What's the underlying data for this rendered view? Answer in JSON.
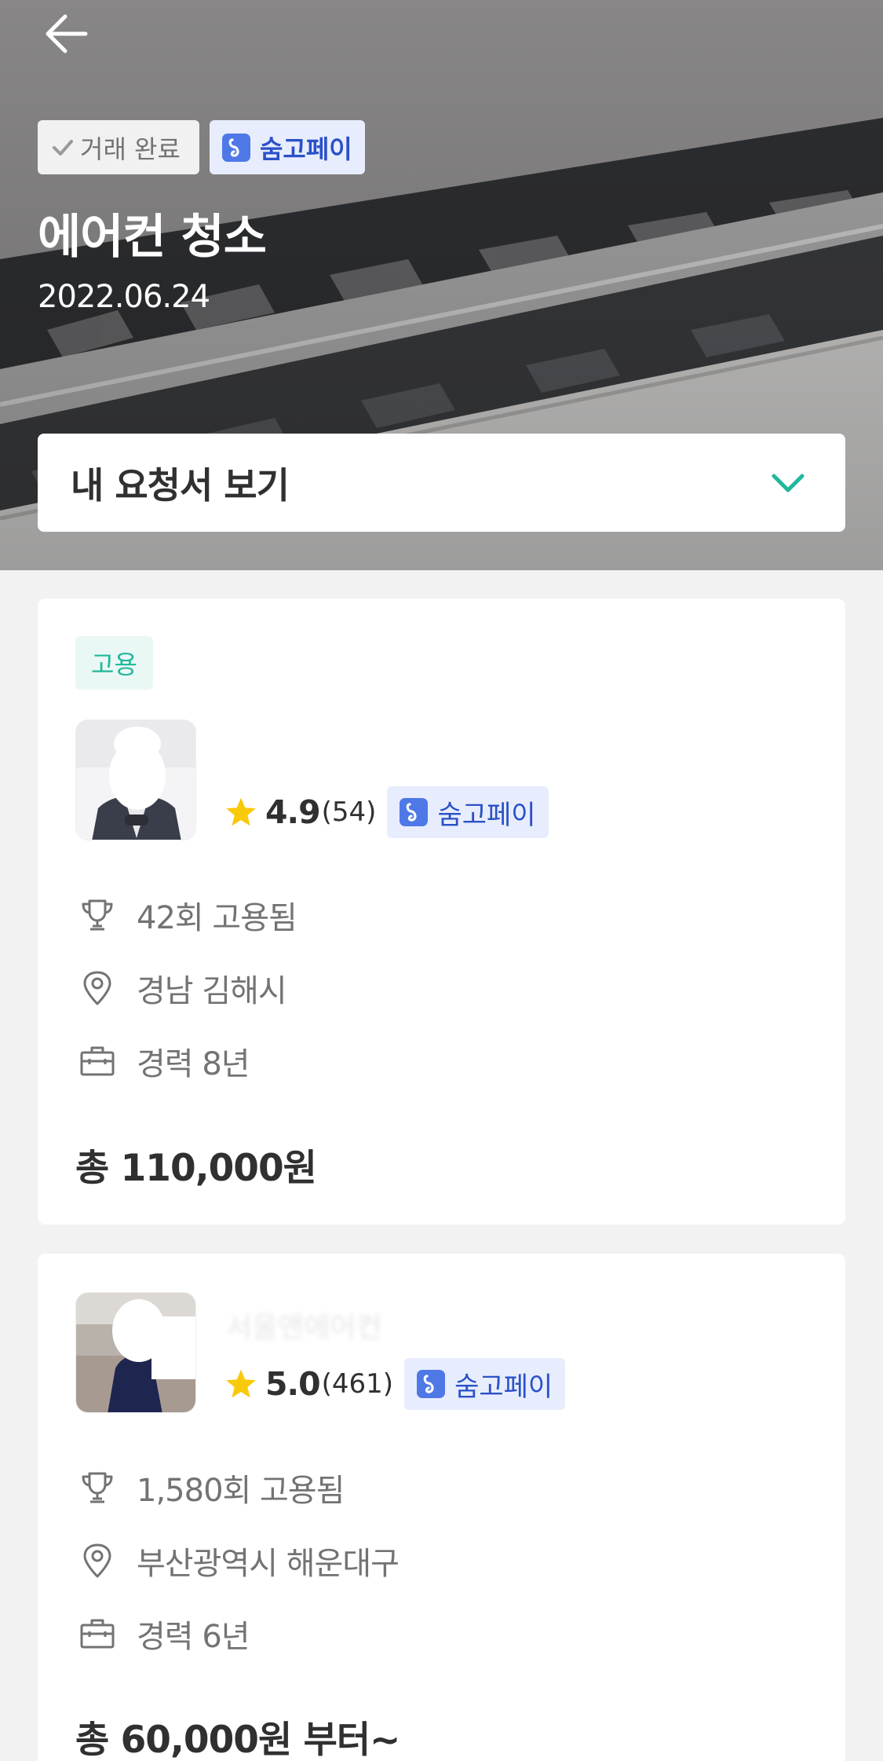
{
  "hero": {
    "status_badge": "거래 완료",
    "pay_badge": "숨고페이",
    "title": "에어컨 청소",
    "date": "2022.06.24",
    "request_toggle": "내 요청서 보기"
  },
  "colors": {
    "accent_green": "#20b89c",
    "pay_blue": "#2a51c8",
    "pay_icon_bg": "#4f78e7",
    "star_yellow": "#f9c90b"
  },
  "quotes": [
    {
      "tag": "고용",
      "rating": "4.9",
      "review_count": "(54)",
      "pay_badge": "숨고페이",
      "hires": "42회 고용됨",
      "location": "경남 김해시",
      "experience": "경력 8년",
      "price": "총 110,000원"
    },
    {
      "name": "서울앤에어컨",
      "rating": "5.0",
      "review_count": "(461)",
      "pay_badge": "숨고페이",
      "hires": "1,580회 고용됨",
      "location": "부산광역시 해운대구",
      "experience": "경력 6년",
      "price": "총 60,000원 부터~"
    }
  ]
}
